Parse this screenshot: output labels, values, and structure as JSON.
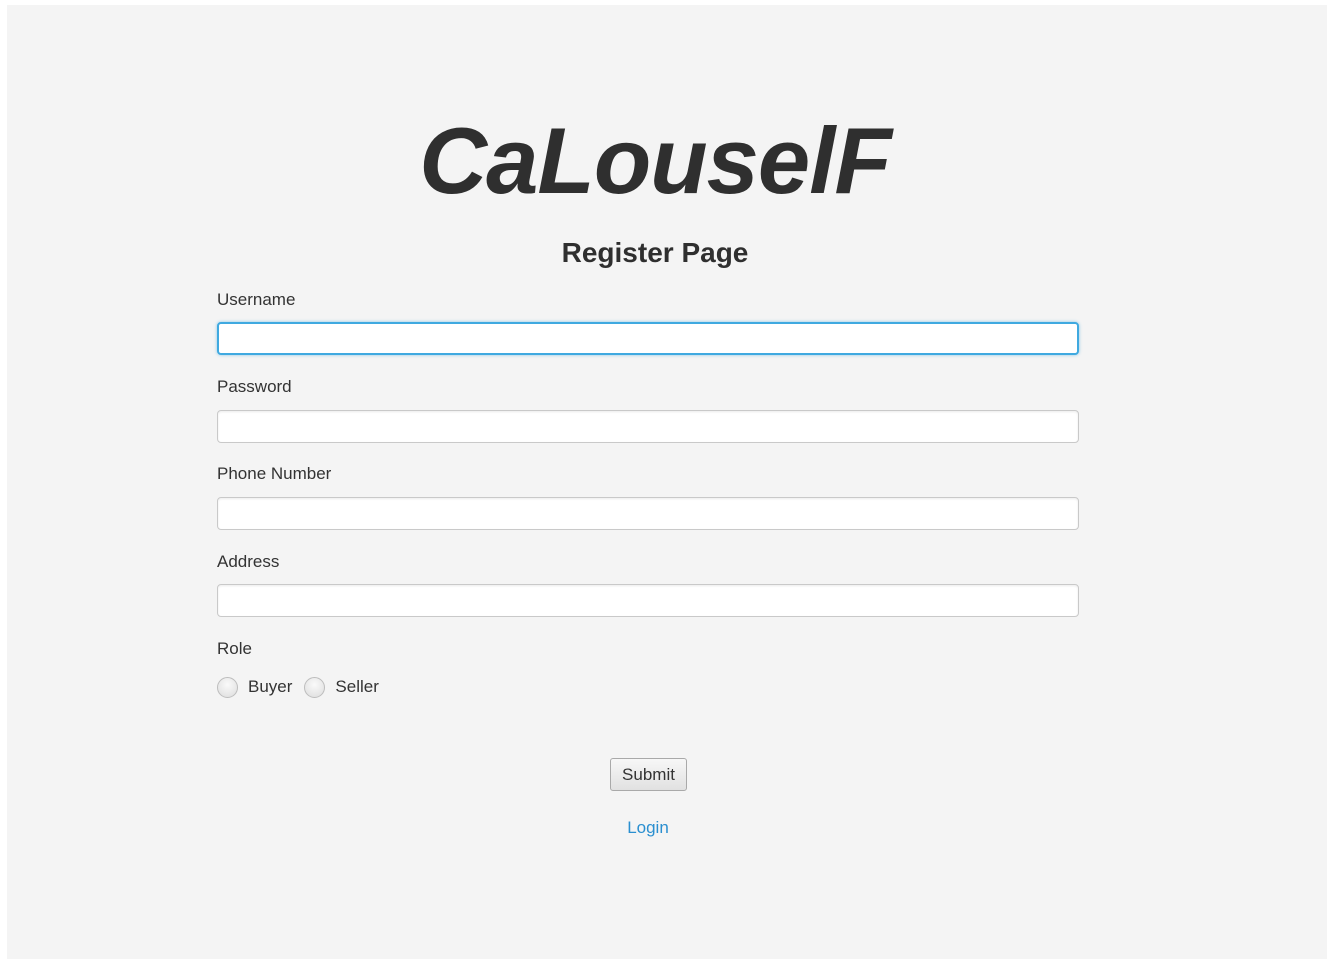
{
  "app": {
    "logo": "CaLouselF",
    "page_title": "Register Page"
  },
  "form": {
    "username": {
      "label": "Username",
      "value": ""
    },
    "password": {
      "label": "Password",
      "value": ""
    },
    "phone": {
      "label": "Phone Number",
      "value": ""
    },
    "address": {
      "label": "Address",
      "value": ""
    },
    "role": {
      "label": "Role",
      "options": [
        "Buyer",
        "Seller"
      ],
      "selected": ""
    },
    "submit_label": "Submit",
    "login_link": "Login"
  },
  "colors": {
    "background": "#f4f4f4",
    "focus_border": "#3fa9e0",
    "link": "#2a8fd0",
    "text": "#333333"
  }
}
